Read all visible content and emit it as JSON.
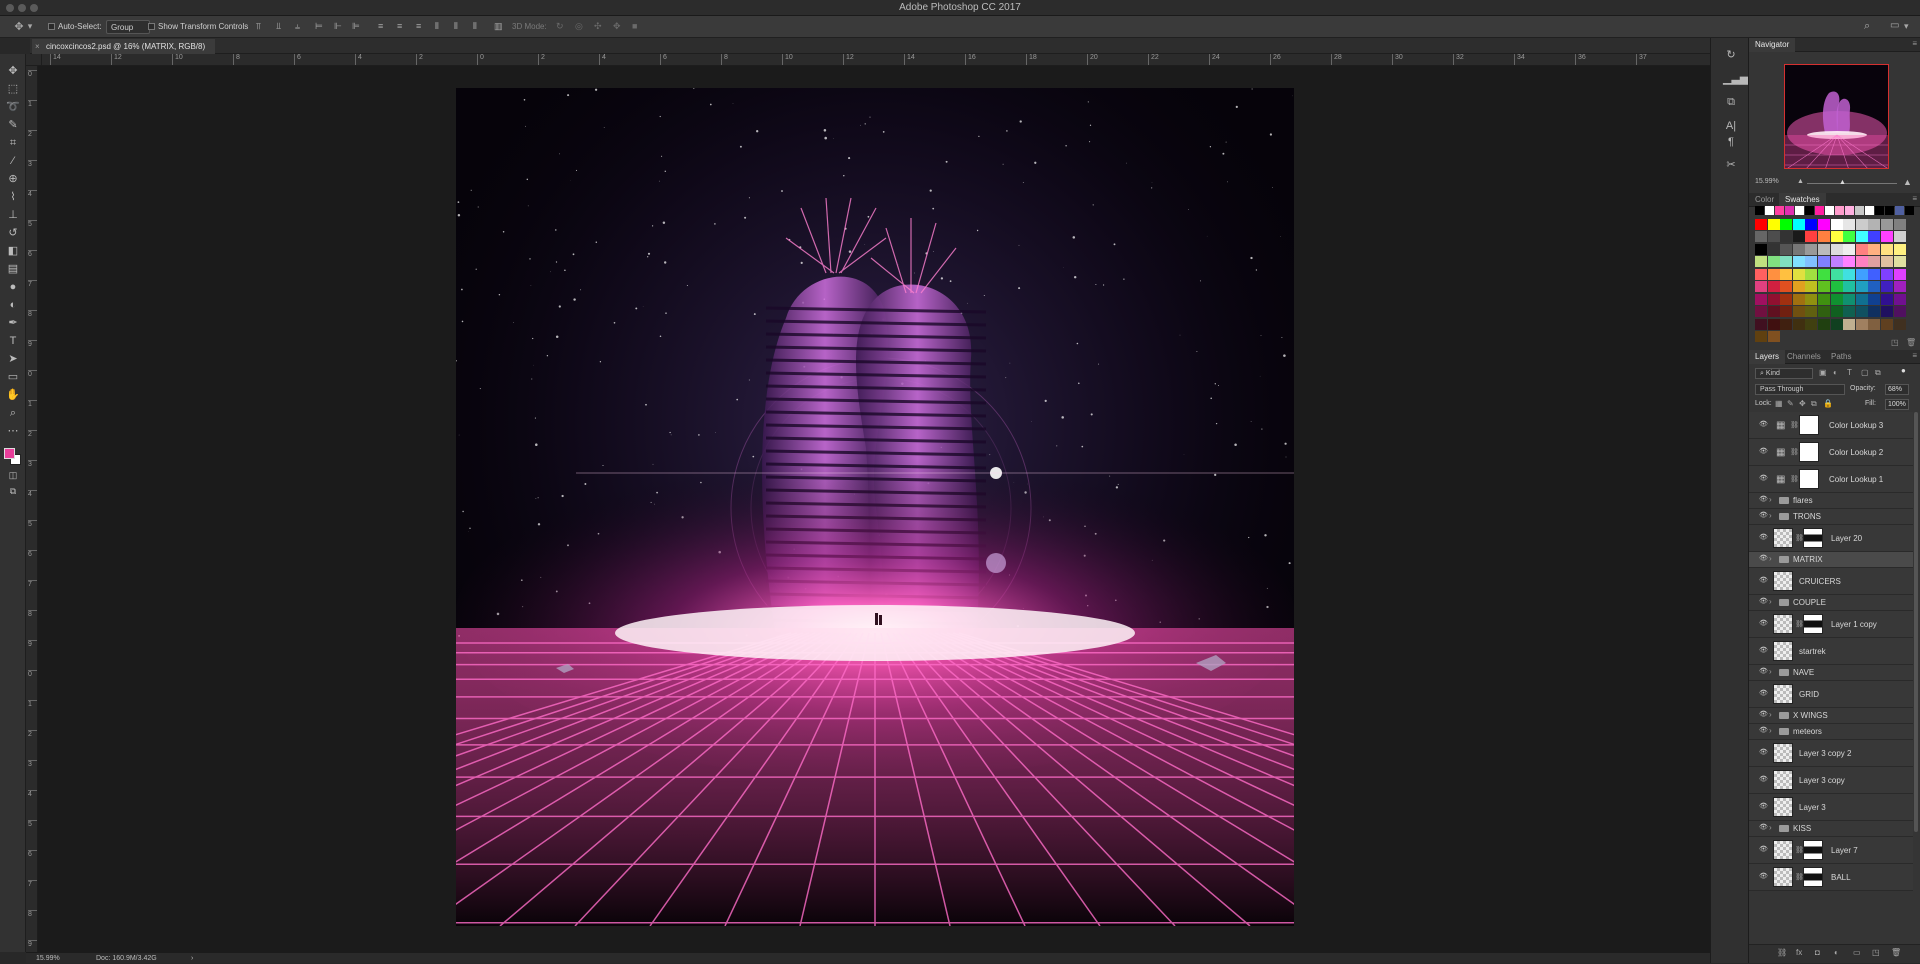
{
  "app": {
    "title": "Adobe Photoshop CC 2017"
  },
  "options_bar": {
    "auto_select_label": "Auto-Select:",
    "auto_select_value": "Group",
    "transform_label": "Show Transform Controls",
    "mode_3d_label": "3D Mode:"
  },
  "document": {
    "tab_label": "cincoxcincos2.psd @ 16% (MATRIX, RGB/8)"
  },
  "rulers": {
    "top_ticks": [
      "14",
      "12",
      "10",
      "8",
      "6",
      "4",
      "2",
      "0",
      "2",
      "4",
      "6",
      "8",
      "10",
      "12",
      "14",
      "16",
      "18",
      "20",
      "22",
      "24",
      "26",
      "28",
      "30",
      "32",
      "34",
      "36",
      "37"
    ],
    "left_ticks": [
      "0",
      "1",
      "2",
      "3",
      "4",
      "5",
      "6",
      "7",
      "8",
      "9",
      "0",
      "1",
      "2",
      "3",
      "4",
      "5",
      "6",
      "7",
      "8",
      "9",
      "0",
      "1",
      "2",
      "3",
      "4",
      "5",
      "6",
      "7",
      "8",
      "9"
    ]
  },
  "status": {
    "zoom": "15.99%",
    "doc_size": "Doc: 160.9M/3.42G",
    "arrow": "›"
  },
  "navigator": {
    "title": "Navigator",
    "zoom": "15.99%"
  },
  "swatches_panel": {
    "tabs": [
      "Color",
      "Swatches"
    ],
    "active_tab": "Swatches",
    "rows": [
      [
        "#000000",
        "#ffffff",
        "#ff3fa0",
        "#e02fb0",
        "#ffffff",
        "#000000",
        "#ff1fa0",
        "#ffffff",
        "#ff9ccc",
        "#ffb0e0",
        "#c8c8c8",
        "#ffffff",
        "#000000",
        "#000000",
        "#5060a0",
        "#000000"
      ],
      [
        "#ff0000",
        "#ffff00",
        "#00ff00",
        "#00ffff",
        "#0000ff",
        "#ff00ff",
        "#ffffff",
        "#e6e6e6",
        "#cccccc",
        "#b3b3b3",
        "#999999",
        "#808080"
      ],
      [
        "#666666",
        "#4d4d4d",
        "#333333",
        "#1a1a1a",
        "#ff4040",
        "#ff8040",
        "#ffff40",
        "#40ff40",
        "#40ffff",
        "#4040ff",
        "#ff40ff",
        "#d0d0d0"
      ],
      [
        "#000000",
        "#333333",
        "#555555",
        "#777777",
        "#999999",
        "#bbbbbb",
        "#dddddd",
        "#eeeeee",
        "#ff8080",
        "#ffb080",
        "#ffe080",
        "#fff080"
      ],
      [
        "#c0e080",
        "#80e080",
        "#80e0c0",
        "#80e0ff",
        "#80c0ff",
        "#8080ff",
        "#c080ff",
        "#ff80ff",
        "#ff80c0",
        "#e0a0a0",
        "#e0c0a0",
        "#e0e0a0"
      ],
      [
        "#ff6060",
        "#ff9040",
        "#ffc040",
        "#e0e040",
        "#a0e040",
        "#40e040",
        "#40e0a0",
        "#40e0e0",
        "#40a0ff",
        "#4060ff",
        "#8040ff",
        "#e040ff"
      ],
      [
        "#e04080",
        "#d02040",
        "#e05020",
        "#e0a020",
        "#c0c020",
        "#60c020",
        "#20c040",
        "#20c0a0",
        "#20a0c0",
        "#2060c0",
        "#4020c0",
        "#a020c0"
      ],
      [
        "#a01060",
        "#901030",
        "#a03010",
        "#a07010",
        "#909010",
        "#409010",
        "#109030",
        "#109070",
        "#107090",
        "#104090",
        "#301090",
        "#701090"
      ],
      [
        "#701040",
        "#601020",
        "#702010",
        "#705010",
        "#606010",
        "#306010",
        "#106020",
        "#106050",
        "#105060",
        "#103060",
        "#201060",
        "#501060"
      ],
      [
        "#401020",
        "#401010",
        "#402010",
        "#403010",
        "#404010",
        "#204010",
        "#104020",
        "#c0b090",
        "#a08060",
        "#806040",
        "#604020",
        "#403020"
      ],
      [
        "#604010",
        "#805020"
      ]
    ]
  },
  "layers_panel": {
    "tabs": [
      "Layers",
      "Channels",
      "Paths"
    ],
    "kind_label": "Kind",
    "blend_mode": "Pass Through",
    "opacity_label": "Opacity:",
    "opacity_value": "68%",
    "lock_label": "Lock:",
    "fill_label": "Fill:",
    "fill_value": "100%",
    "layers": [
      {
        "name": "Color Lookup 3",
        "type": "adjustment",
        "selected": false
      },
      {
        "name": "Color Lookup 2",
        "type": "adjustment",
        "selected": false
      },
      {
        "name": "Color Lookup 1",
        "type": "adjustment",
        "selected": false
      },
      {
        "name": "flares",
        "type": "group",
        "selected": false
      },
      {
        "name": "TRONS",
        "type": "group",
        "selected": false
      },
      {
        "name": "Layer 20",
        "type": "masked",
        "selected": false
      },
      {
        "name": "MATRIX",
        "type": "group",
        "selected": true
      },
      {
        "name": "CRUICERS",
        "type": "pixel",
        "selected": false
      },
      {
        "name": "COUPLE",
        "type": "group",
        "selected": false
      },
      {
        "name": "Layer 1 copy",
        "type": "masked",
        "selected": false
      },
      {
        "name": "startrek",
        "type": "pixel",
        "selected": false
      },
      {
        "name": "NAVE",
        "type": "group",
        "selected": false
      },
      {
        "name": "GRID",
        "type": "pixel",
        "selected": false
      },
      {
        "name": "X WINGS",
        "type": "group",
        "selected": false
      },
      {
        "name": "meteors",
        "type": "group",
        "selected": false
      },
      {
        "name": "Layer 3 copy 2",
        "type": "pixel",
        "selected": false
      },
      {
        "name": "Layer 3 copy",
        "type": "pixel",
        "selected": false
      },
      {
        "name": "Layer 3",
        "type": "pixel",
        "selected": false
      },
      {
        "name": "KISS",
        "type": "group",
        "selected": false
      },
      {
        "name": "Layer 7",
        "type": "masked",
        "selected": false
      },
      {
        "name": "BALL",
        "type": "masked",
        "selected": false
      }
    ],
    "footer_icons": [
      "link-icon",
      "fx-icon",
      "mask-icon",
      "adjustment-icon",
      "group-icon",
      "new-layer-icon",
      "trash-icon"
    ]
  },
  "colors": {
    "accent_pink": "#ff3fa0",
    "foreground": "#e83e9a",
    "background": "#ffffff"
  }
}
